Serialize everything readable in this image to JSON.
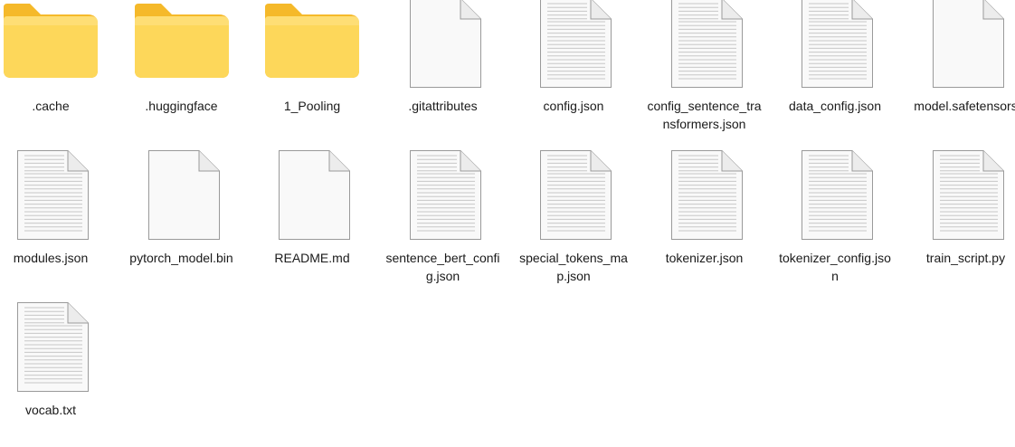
{
  "explorer": {
    "items": [
      {
        "name": ".cache",
        "type": "folder",
        "icon": "folder-icon"
      },
      {
        "name": ".huggingface",
        "type": "folder",
        "icon": "folder-icon"
      },
      {
        "name": "1_Pooling",
        "type": "folder",
        "icon": "folder-icon"
      },
      {
        "name": ".gitattributes",
        "type": "file",
        "icon": "blank-file-icon"
      },
      {
        "name": "config.json",
        "type": "file",
        "icon": "text-file-icon"
      },
      {
        "name": "config_sentence_transformers.json",
        "type": "file",
        "icon": "text-file-icon"
      },
      {
        "name": "data_config.json",
        "type": "file",
        "icon": "text-file-icon"
      },
      {
        "name": "model.safetensors",
        "type": "file",
        "icon": "blank-file-icon"
      },
      {
        "name": "modules.json",
        "type": "file",
        "icon": "text-file-icon"
      },
      {
        "name": "pytorch_model.bin",
        "type": "file",
        "icon": "blank-file-icon"
      },
      {
        "name": "README.md",
        "type": "file",
        "icon": "blank-file-icon"
      },
      {
        "name": "sentence_bert_config.json",
        "type": "file",
        "icon": "text-file-icon"
      },
      {
        "name": "special_tokens_map.json",
        "type": "file",
        "icon": "text-file-icon"
      },
      {
        "name": "tokenizer.json",
        "type": "file",
        "icon": "text-file-icon"
      },
      {
        "name": "tokenizer_config.json",
        "type": "file",
        "icon": "text-file-icon"
      },
      {
        "name": "train_script.py",
        "type": "file",
        "icon": "text-file-icon"
      },
      {
        "name": "vocab.txt",
        "type": "file",
        "icon": "text-file-icon"
      }
    ],
    "colors": {
      "folder_back": "#f5b92a",
      "folder_front": "#fdd75a",
      "file_page": "#f9f9f9",
      "file_border": "#9a9a9a",
      "file_lines": "#c8c8c8",
      "label_text": "#1a1a1a"
    }
  }
}
